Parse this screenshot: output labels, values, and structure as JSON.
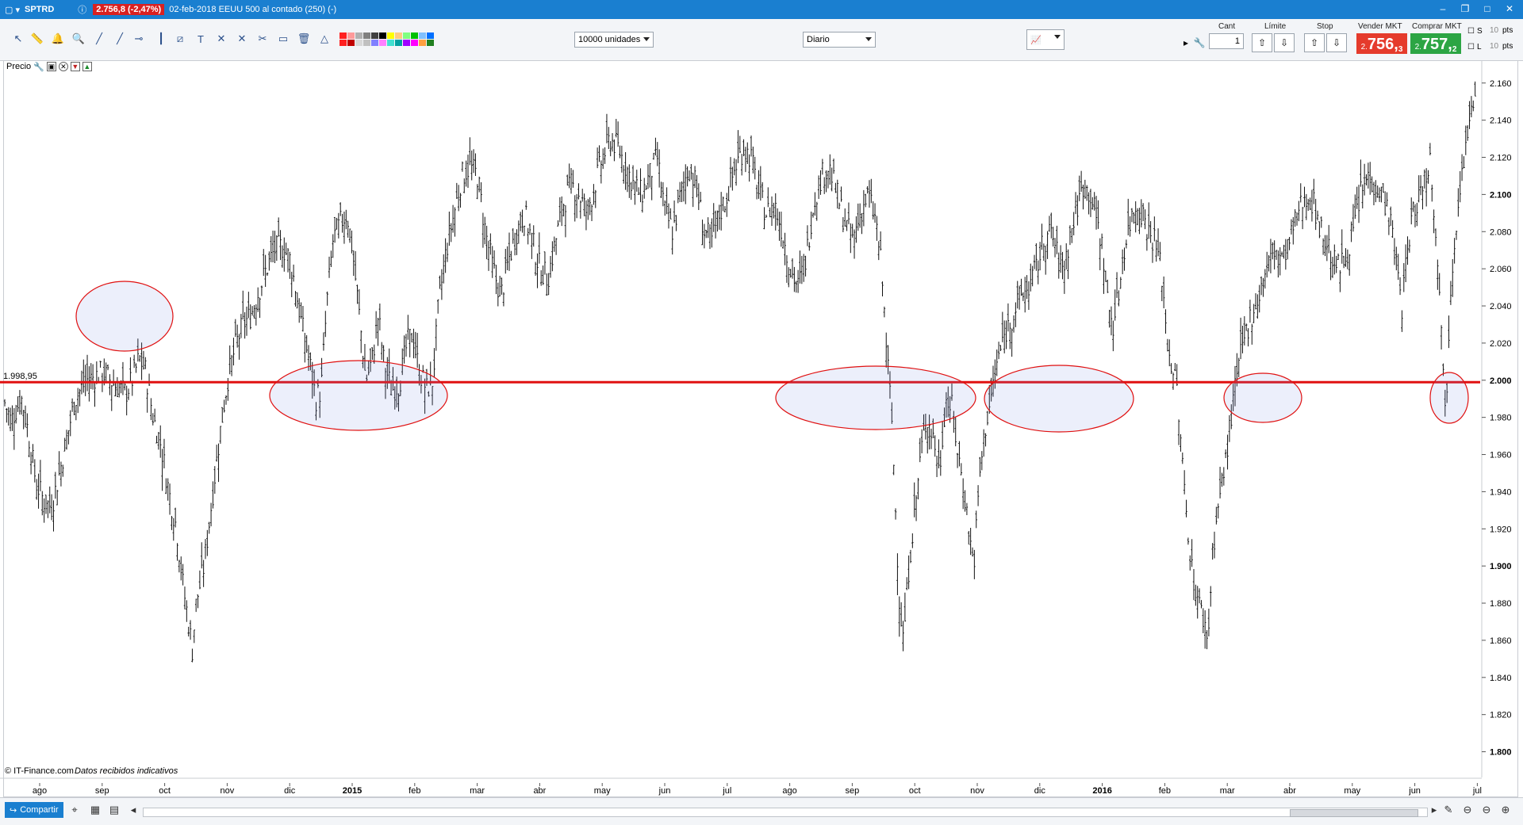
{
  "window": {
    "symbol": "SPTRD",
    "price_badge": "2.756,8 (-2,47%)",
    "title": "02-feb-2018 EEUU 500 al contado (250) (-)"
  },
  "toolbar": {
    "quantity_select": "10000 unidades",
    "period_select": "Diario",
    "swatch_colors": [
      "#ff2020",
      "#ff9a9a",
      "#b0b0b0",
      "#808080",
      "#404040",
      "#000000",
      "#ffff00",
      "#ffcc80",
      "#80ff80",
      "#00c000",
      "#80c0ff",
      "#0070ff",
      "#ff2020",
      "#c00000",
      "#d8d8d8",
      "#c0c0c0",
      "#8080ff",
      "#ff80ff",
      "#40e0d0",
      "#00a0a0",
      "#a000ff",
      "#ff00ff",
      "#ffa040",
      "#208020"
    ]
  },
  "order_panel": {
    "cant_label": "Cant",
    "qty_value": "1",
    "limit_label": "Límite",
    "stop_label": "Stop",
    "sell_label": "Vender MKT",
    "buy_label": "Comprar MKT",
    "sell_prefix": "2.",
    "sell_main": "756,",
    "sell_sup": "3",
    "buy_prefix": "2.",
    "buy_main": "757,",
    "buy_sup": "2",
    "s_label": "S",
    "l_label": "L",
    "pts_value": "10",
    "pts_label": "pts"
  },
  "chart_panel": {
    "label": "Precio",
    "source_note": "© IT-Finance.com",
    "data_note": "Datos recibidos indicativos",
    "level_label": "1.998,95"
  },
  "bottom": {
    "share_label": "Compartir"
  },
  "chart_data": {
    "type": "bar",
    "subtype": "ohlc",
    "horizontal_level": 1998.95,
    "ylim": [
      1790,
      2168
    ],
    "y_ticks": [
      1800,
      1820,
      1840,
      1860,
      1880,
      1900,
      1920,
      1940,
      1960,
      1980,
      2000,
      2020,
      2040,
      2060,
      2080,
      2100,
      2120,
      2140,
      2160
    ],
    "y_tick_labels": [
      "1.800",
      "1.820",
      "1.840",
      "1.860",
      "1.880",
      "1.900",
      "1.920",
      "1.940",
      "1.960",
      "1.980",
      "2.000",
      "2.020",
      "2.040",
      "2.060",
      "2.080",
      "2.100",
      "2.120",
      "2.140",
      "2.160"
    ],
    "x_tick_labels": [
      "ago",
      "sep",
      "oct",
      "nov",
      "dic",
      "2015",
      "feb",
      "mar",
      "abr",
      "may",
      "jun",
      "jul",
      "ago",
      "sep",
      "oct",
      "nov",
      "dic",
      "2016",
      "feb",
      "mar",
      "abr",
      "may",
      "jun",
      "jul"
    ],
    "close_path": [
      [
        0,
        1988
      ],
      [
        8,
        1978
      ],
      [
        15,
        1985
      ],
      [
        22,
        1990
      ],
      [
        30,
        1972
      ],
      [
        40,
        1945
      ],
      [
        50,
        1935
      ],
      [
        60,
        1932
      ],
      [
        70,
        1950
      ],
      [
        80,
        1970
      ],
      [
        90,
        1990
      ],
      [
        105,
        2000
      ],
      [
        115,
        2002
      ],
      [
        125,
        2004
      ],
      [
        135,
        2000
      ],
      [
        145,
        1996
      ],
      [
        155,
        1993
      ],
      [
        165,
        2002
      ],
      [
        172,
        2012
      ],
      [
        180,
        2005
      ],
      [
        190,
        1980
      ],
      [
        200,
        1965
      ],
      [
        210,
        1940
      ],
      [
        220,
        1920
      ],
      [
        228,
        1890
      ],
      [
        235,
        1870
      ],
      [
        240,
        1855
      ],
      [
        245,
        1880
      ],
      [
        255,
        1900
      ],
      [
        265,
        1935
      ],
      [
        275,
        1970
      ],
      [
        285,
        2000
      ],
      [
        295,
        2018
      ],
      [
        305,
        2030
      ],
      [
        315,
        2035
      ],
      [
        325,
        2048
      ],
      [
        335,
        2060
      ],
      [
        345,
        2070
      ],
      [
        355,
        2072
      ],
      [
        365,
        2065
      ],
      [
        372,
        2050
      ],
      [
        380,
        2030
      ],
      [
        390,
        2010
      ],
      [
        398,
        1990
      ],
      [
        405,
        1995
      ],
      [
        412,
        2040
      ],
      [
        420,
        2075
      ],
      [
        430,
        2085
      ],
      [
        438,
        2090
      ],
      [
        445,
        2070
      ],
      [
        455,
        2030
      ],
      [
        462,
        2000
      ],
      [
        470,
        2010
      ],
      [
        478,
        2035
      ],
      [
        485,
        2010
      ],
      [
        495,
        1995
      ],
      [
        505,
        1998
      ],
      [
        515,
        2020
      ],
      [
        522,
        2025
      ],
      [
        530,
        2005
      ],
      [
        540,
        1995
      ],
      [
        548,
        2000
      ],
      [
        555,
        2040
      ],
      [
        565,
        2070
      ],
      [
        575,
        2090
      ],
      [
        585,
        2110
      ],
      [
        595,
        2115
      ],
      [
        605,
        2110
      ],
      [
        615,
        2080
      ],
      [
        625,
        2060
      ],
      [
        635,
        2045
      ],
      [
        645,
        2065
      ],
      [
        655,
        2080
      ],
      [
        665,
        2090
      ],
      [
        675,
        2075
      ],
      [
        685,
        2060
      ],
      [
        695,
        2055
      ],
      [
        705,
        2075
      ],
      [
        715,
        2095
      ],
      [
        725,
        2105
      ],
      [
        735,
        2100
      ],
      [
        745,
        2090
      ],
      [
        755,
        2105
      ],
      [
        765,
        2120
      ],
      [
        775,
        2130
      ],
      [
        785,
        2125
      ],
      [
        795,
        2115
      ],
      [
        805,
        2105
      ],
      [
        815,
        2100
      ],
      [
        825,
        2110
      ],
      [
        835,
        2120
      ],
      [
        845,
        2090
      ],
      [
        855,
        2080
      ],
      [
        865,
        2100
      ],
      [
        875,
        2115
      ],
      [
        885,
        2105
      ],
      [
        895,
        2080
      ],
      [
        905,
        2075
      ],
      [
        915,
        2090
      ],
      [
        925,
        2100
      ],
      [
        935,
        2115
      ],
      [
        945,
        2125
      ],
      [
        955,
        2120
      ],
      [
        965,
        2100
      ],
      [
        975,
        2090
      ],
      [
        985,
        2095
      ],
      [
        995,
        2080
      ],
      [
        1005,
        2060
      ],
      [
        1015,
        2050
      ],
      [
        1025,
        2065
      ],
      [
        1035,
        2095
      ],
      [
        1045,
        2110
      ],
      [
        1055,
        2115
      ],
      [
        1065,
        2100
      ],
      [
        1075,
        2085
      ],
      [
        1085,
        2075
      ],
      [
        1095,
        2090
      ],
      [
        1105,
        2100
      ],
      [
        1115,
        2085
      ],
      [
        1122,
        2060
      ],
      [
        1128,
        2020
      ],
      [
        1135,
        1980
      ],
      [
        1140,
        1930
      ],
      [
        1145,
        1880
      ],
      [
        1150,
        1860
      ],
      [
        1158,
        1905
      ],
      [
        1165,
        1930
      ],
      [
        1172,
        1960
      ],
      [
        1180,
        1980
      ],
      [
        1188,
        1970
      ],
      [
        1196,
        1950
      ],
      [
        1204,
        1990
      ],
      [
        1212,
        1985
      ],
      [
        1220,
        1960
      ],
      [
        1228,
        1940
      ],
      [
        1235,
        1915
      ],
      [
        1240,
        1900
      ],
      [
        1248,
        1950
      ],
      [
        1255,
        1975
      ],
      [
        1262,
        1990
      ],
      [
        1270,
        2010
      ],
      [
        1280,
        2025
      ],
      [
        1290,
        2035
      ],
      [
        1300,
        2045
      ],
      [
        1310,
        2050
      ],
      [
        1320,
        2060
      ],
      [
        1330,
        2075
      ],
      [
        1340,
        2080
      ],
      [
        1348,
        2065
      ],
      [
        1355,
        2060
      ],
      [
        1362,
        2075
      ],
      [
        1370,
        2090
      ],
      [
        1380,
        2105
      ],
      [
        1390,
        2100
      ],
      [
        1398,
        2085
      ],
      [
        1405,
        2070
      ],
      [
        1412,
        2040
      ],
      [
        1418,
        2030
      ],
      [
        1425,
        2045
      ],
      [
        1432,
        2070
      ],
      [
        1440,
        2085
      ],
      [
        1448,
        2095
      ],
      [
        1456,
        2090
      ],
      [
        1464,
        2080
      ],
      [
        1472,
        2075
      ],
      [
        1480,
        2060
      ],
      [
        1488,
        2020
      ],
      [
        1495,
        2005
      ],
      [
        1500,
        1995
      ],
      [
        1505,
        1965
      ],
      [
        1512,
        1930
      ],
      [
        1520,
        1895
      ],
      [
        1528,
        1880
      ],
      [
        1535,
        1870
      ],
      [
        1540,
        1860
      ],
      [
        1545,
        1905
      ],
      [
        1552,
        1930
      ],
      [
        1560,
        1950
      ],
      [
        1568,
        1975
      ],
      [
        1576,
        2000
      ],
      [
        1585,
        2020
      ],
      [
        1595,
        2035
      ],
      [
        1605,
        2045
      ],
      [
        1615,
        2060
      ],
      [
        1625,
        2070
      ],
      [
        1635,
        2065
      ],
      [
        1645,
        2075
      ],
      [
        1655,
        2090
      ],
      [
        1665,
        2100
      ],
      [
        1675,
        2095
      ],
      [
        1685,
        2080
      ],
      [
        1695,
        2070
      ],
      [
        1705,
        2060
      ],
      [
        1715,
        2065
      ],
      [
        1725,
        2080
      ],
      [
        1735,
        2100
      ],
      [
        1745,
        2110
      ],
      [
        1755,
        2105
      ],
      [
        1762,
        2100
      ],
      [
        1768,
        2095
      ],
      [
        1775,
        2080
      ],
      [
        1782,
        2060
      ],
      [
        1788,
        2040
      ],
      [
        1795,
        2070
      ],
      [
        1802,
        2090
      ],
      [
        1810,
        2100
      ],
      [
        1818,
        2110
      ],
      [
        1824,
        2120
      ],
      [
        1828,
        2095
      ],
      [
        1832,
        2080
      ],
      [
        1836,
        2050
      ],
      [
        1840,
        2010
      ],
      [
        1842,
        1990
      ],
      [
        1846,
        2000
      ],
      [
        1850,
        2050
      ],
      [
        1856,
        2080
      ],
      [
        1862,
        2105
      ],
      [
        1868,
        2120
      ],
      [
        1872,
        2130
      ],
      [
        1876,
        2140
      ],
      [
        1880,
        2150
      ],
      [
        1884,
        2158
      ]
    ]
  }
}
